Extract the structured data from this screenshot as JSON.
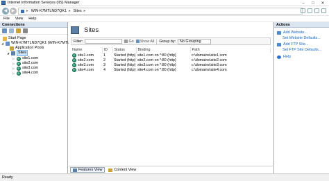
{
  "window": {
    "title": "Internet Information Services (IIS) Manager",
    "controls": {
      "minimize": "–",
      "maximize": "□",
      "close": "✕"
    }
  },
  "address": {
    "back": "◀",
    "forward": "▶",
    "breadcrumbs": [
      "WIN-K7MTLND7QK1",
      "Sites"
    ],
    "separator": "▸"
  },
  "menu": [
    "File",
    "View",
    "Help"
  ],
  "connections": {
    "header": "Connections",
    "tree": [
      {
        "label": "Start Page",
        "level": 0,
        "icon": "start-page-icon"
      },
      {
        "label": "WIN-K7MTLND7QK1 (WIN-K7MTLNE",
        "level": 0,
        "icon": "server-icon",
        "expander": "◢"
      },
      {
        "label": "Application Pools",
        "level": 1,
        "icon": "app-pools-icon"
      },
      {
        "label": "Sites",
        "level": 1,
        "icon": "sites-icon",
        "expander": "◢",
        "selected": true
      },
      {
        "label": "site1.com",
        "level": 2,
        "icon": "globe-icon",
        "expander": "▷"
      },
      {
        "label": "site2.com",
        "level": 2,
        "icon": "globe-icon",
        "expander": "▷"
      },
      {
        "label": "site3.com",
        "level": 2,
        "icon": "globe-icon",
        "expander": "▷"
      },
      {
        "label": "site4.com",
        "level": 2,
        "icon": "globe-icon",
        "expander": "▷"
      }
    ]
  },
  "main": {
    "title": "Sites",
    "filter": {
      "label": "Filter:",
      "go_label": "Go",
      "show_all_label": "Show All",
      "group_by_label": "Group by:",
      "group_by_value": "No Grouping"
    },
    "columns": [
      "Name",
      "ID",
      "Status",
      "Binding",
      "Path"
    ],
    "rows": [
      [
        "site1.com",
        "1",
        "Started (http)",
        "site1.com on *:80 (http)",
        "c:\\domains\\site1.com"
      ],
      [
        "site2.com",
        "2",
        "Started (http)",
        "site2.com on *:80 (http)",
        "c:\\domains\\site2.com"
      ],
      [
        "site3.com",
        "3",
        "Started (http)",
        "site3.com on *:80 (http)",
        "c:\\domains\\site3.com"
      ],
      [
        "site4.com",
        "4",
        "Started (http)",
        "site4.com on *:80 (http)",
        "c:\\domains\\site4.com"
      ]
    ],
    "tabs": [
      "Features View",
      "Content View"
    ]
  },
  "actions": {
    "header": "Actions",
    "items": [
      "Add Website...",
      "Set Website Defaults...",
      "Add FTP Site...",
      "Set FTP Site Defaults...",
      "Help"
    ]
  },
  "status": "Ready"
}
